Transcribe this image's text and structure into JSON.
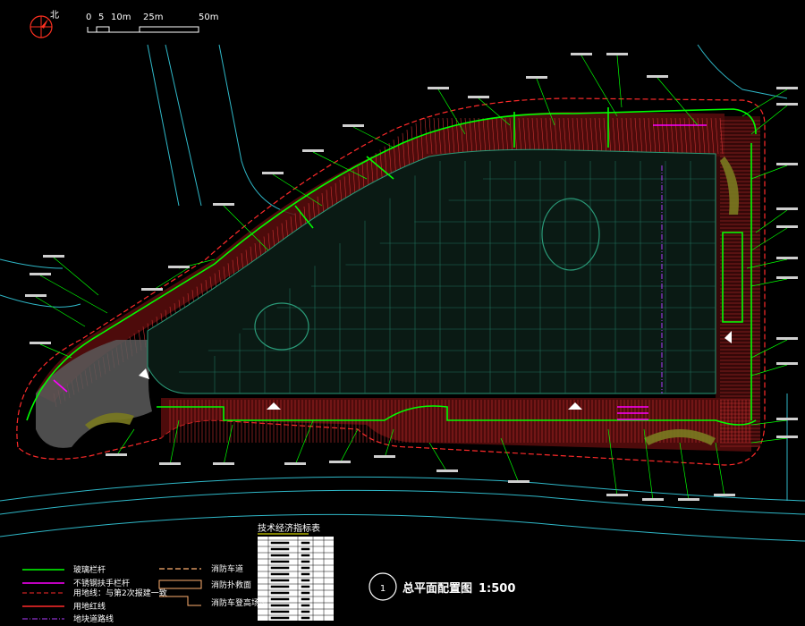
{
  "compass": {
    "north_mark": "北",
    "icon": "north-arrow-icon"
  },
  "scale_bar": {
    "ticks": [
      "0",
      "5",
      "10m",
      "25m",
      "50m"
    ]
  },
  "title_block": {
    "number": "1",
    "title": "总平面配置图",
    "scale": "1:500"
  },
  "table": {
    "title": "技术经济指标表"
  },
  "legend": {
    "left": [
      {
        "label": "玻璃栏杆",
        "color": "#00ff00",
        "style": "solid"
      },
      {
        "label": "不锈钢扶手栏杆",
        "color": "#ff00ff",
        "style": "solid"
      },
      {
        "label": "用地线：与第2次报建一致",
        "color": "#ff2a2a",
        "style": "dashed"
      },
      {
        "label": "用地红线",
        "color": "#ff2a2a",
        "style": "solid"
      },
      {
        "label": "地块道路线",
        "color": "#b03cff",
        "style": "dashdot"
      }
    ],
    "right": [
      {
        "label": "消防车道",
        "color": "#ffb070",
        "style": "dashed"
      },
      {
        "label": "消防扑救面",
        "color": "#ffb070",
        "style": "box"
      },
      {
        "label": "消防车登高场地",
        "color": "#ffb070",
        "style": "step"
      }
    ]
  },
  "colors": {
    "background": "#000000",
    "glass_railing": "#00ff00",
    "steel_railing": "#ff00ff",
    "boundary": "#ff2a2a",
    "road": "#2fb8c8",
    "building": "#1f6f5a",
    "fire": "#ffb070",
    "text": "#ffffff"
  }
}
